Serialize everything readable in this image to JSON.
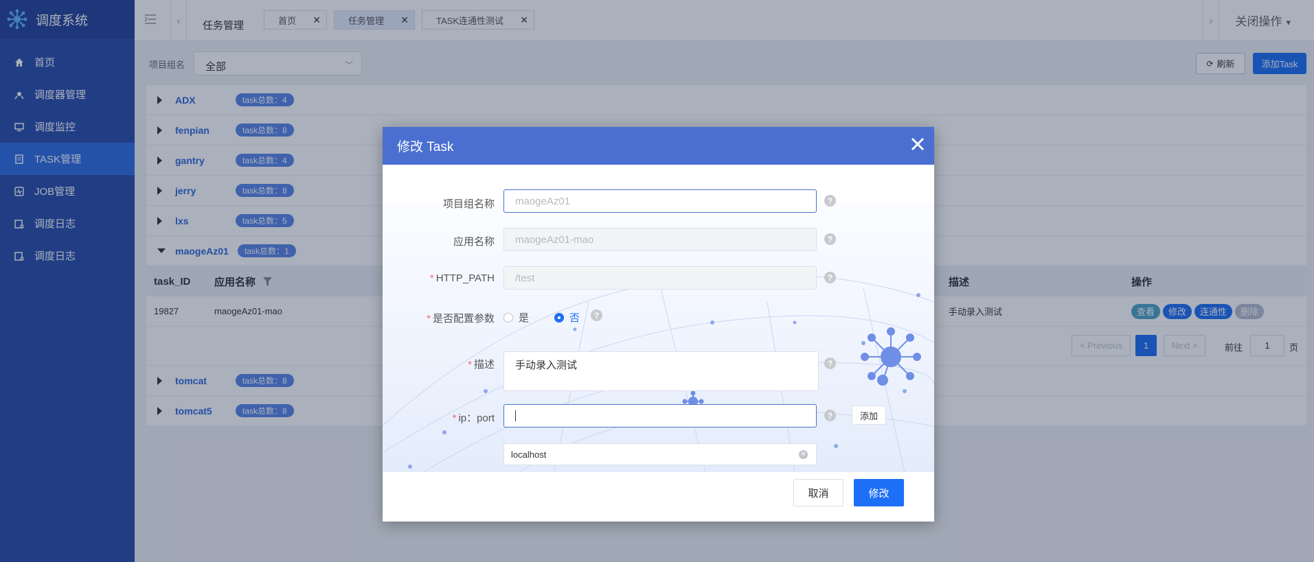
{
  "app": {
    "title": "调度系统"
  },
  "sidebar": {
    "items": [
      {
        "label": "首页",
        "icon": "home-icon",
        "active": false
      },
      {
        "label": "调度器管理",
        "icon": "scheduler-icon",
        "active": false
      },
      {
        "label": "调度监控",
        "icon": "monitor-icon",
        "active": false
      },
      {
        "label": "TASK管理",
        "icon": "task-icon",
        "active": true
      },
      {
        "label": "JOB管理",
        "icon": "job-icon",
        "active": false
      },
      {
        "label": "调度日志",
        "icon": "log-icon",
        "active": false
      },
      {
        "label": "调度日志",
        "icon": "log-icon",
        "active": false
      }
    ]
  },
  "topbar": {
    "breadcrumb": "任务管理",
    "tabs": [
      {
        "label": "首页",
        "active": false
      },
      {
        "label": "任务管理",
        "active": true
      },
      {
        "label": "TASK连通性测试",
        "active": false
      }
    ],
    "close_ops": "关闭操作"
  },
  "filter": {
    "label": "项目组名",
    "value": "全部"
  },
  "actions": {
    "refresh": "刷新",
    "add": "添加Task"
  },
  "groups": [
    {
      "name": "ADX",
      "badge": "task总数：4",
      "expanded": false
    },
    {
      "name": "fenpian",
      "badge": "task总数：8",
      "expanded": false
    },
    {
      "name": "gantry",
      "badge": "task总数：4",
      "expanded": false
    },
    {
      "name": "jerry",
      "badge": "task总数：8",
      "expanded": false
    },
    {
      "name": "lxs",
      "badge": "task总数：5",
      "expanded": false
    },
    {
      "name": "maogeAz01",
      "badge": "task总数：1",
      "expanded": true
    },
    {
      "name": "tomcat",
      "badge": "task总数：8",
      "expanded": false
    },
    {
      "name": "tomcat5",
      "badge": "task总数：8",
      "expanded": false
    }
  ],
  "table": {
    "headers": {
      "task_id": "task_ID",
      "app_name": "应用名称",
      "desc": "描述",
      "ops": "操作"
    },
    "row": {
      "task_id": "19827",
      "app_name": "maogeAz01-mao",
      "desc": "手动录入测试"
    },
    "ops": {
      "view": "查看",
      "edit": "修改",
      "conn": "连通性",
      "delete": "删除"
    },
    "pager": {
      "prev": "< Previous",
      "current": "1",
      "next": "Next >",
      "goto": "前往",
      "page_value": "1",
      "page_unit": "页"
    }
  },
  "dialog": {
    "title": "修改 Task",
    "fields": {
      "group_label": "项目组名称",
      "group_value": "maogeAz01",
      "app_label": "应用名称",
      "app_value": "maogeAz01-mao",
      "path_label": "HTTP_PATH",
      "path_value": "/test",
      "config_label": "是否配置参数",
      "config_yes": "是",
      "config_no": "否",
      "desc_label": "描述",
      "desc_value": "手动录入测试",
      "ip_label": "ip：port",
      "ip_value": "",
      "add_btn": "添加",
      "tag": "localhost"
    },
    "cancel": "取消",
    "submit": "修改"
  },
  "colors": {
    "sidebar": "#2a4da9",
    "primary": "#1d6ff5",
    "dialog_header": "#4a6fd0",
    "badge": "#5a86e6",
    "required": "#f56c6c"
  }
}
